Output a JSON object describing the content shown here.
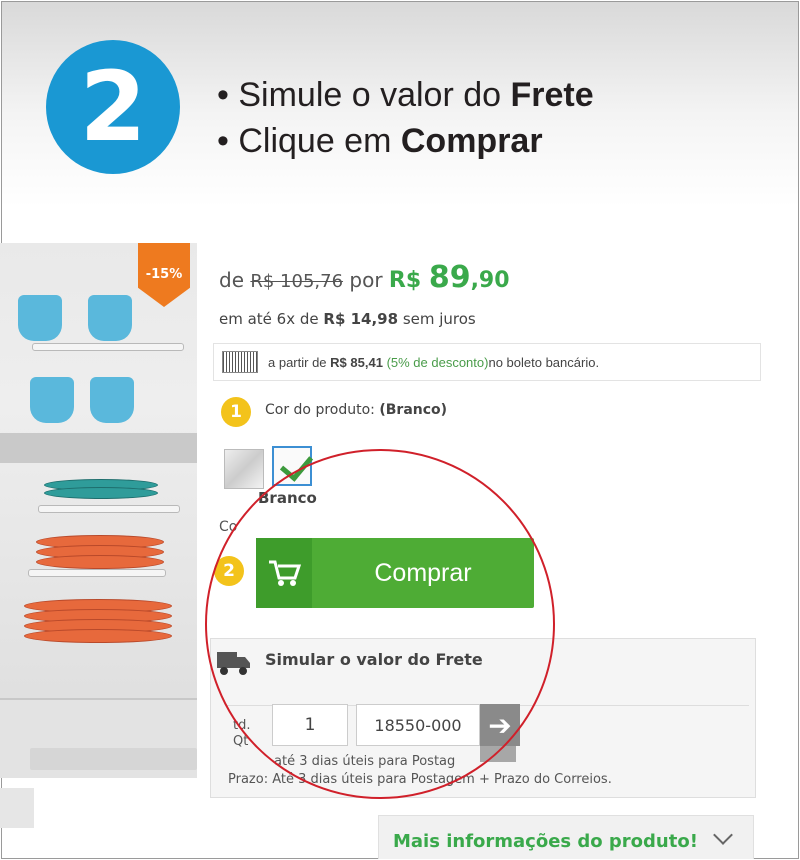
{
  "step": {
    "number": "2",
    "bullet1_pre": "• Simule o valor do ",
    "bullet1_bold": "Frete",
    "bullet2_pre": "• Clique em ",
    "bullet2_bold": "Comprar"
  },
  "product": {
    "discount_badge": "-15%",
    "price_de": "de ",
    "old_price": "R$ 105,76",
    "price_por": " por ",
    "price_currency": "R$ ",
    "price_int": "89",
    "price_dec": ",90",
    "installment_pre": "em até 6x de ",
    "installment_value": "R$ 14,98",
    "installment_post": " sem juros",
    "boleto_pre": "a partir de ",
    "boleto_value": "R$ 85,41",
    "boleto_disc": "(5% de desconto)",
    "boleto_post": " no boleto bancário."
  },
  "color": {
    "badge": "1",
    "label": "Cor do produto: ",
    "value": "(Branco)",
    "selected_name": "Branco",
    "cut_label": "Co"
  },
  "buy": {
    "badge": "2",
    "label": "Comprar"
  },
  "shipping": {
    "title": "Simular o valor do Frete",
    "qty_label_line1": "td.",
    "qty_label_line2": "Qt",
    "qty_value": "1",
    "cep_value": "18550-000",
    "go_label": "➔",
    "prazo_line1": "até 3 dias úteis para Postag",
    "prazo_line2": "Prazo: Até 3 dias úteis para Postagem + Prazo do Correios."
  },
  "more_info": {
    "label": "Mais informações do produto!"
  },
  "colors": {
    "accent_blue": "#1a98d3",
    "buy_green": "#4eac35",
    "price_green": "#3aa94b",
    "badge_yellow": "#f3c31b",
    "discount_orange": "#ee7a1f",
    "highlight_red": "#d0202a"
  }
}
